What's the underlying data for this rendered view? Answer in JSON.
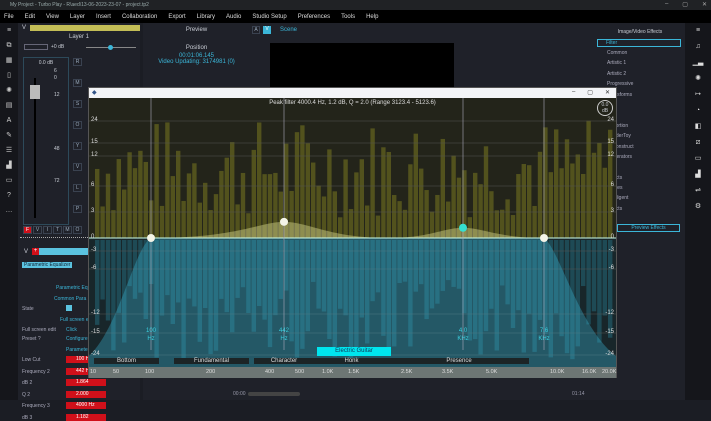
{
  "window": {
    "title": "My Project - Turbo Play - R\\aed\\13-06-2023-23-07 - project.tp2",
    "controls": [
      "–",
      "▢",
      "✕"
    ]
  },
  "menu": [
    "File",
    "Edit",
    "View",
    "Layer",
    "Insert",
    "Collaboration",
    "Export",
    "Library",
    "Audio",
    "Studio Setup",
    "Preferences",
    "Tools",
    "Help"
  ],
  "left_icons": [
    "menu-icon",
    "copy-icon",
    "grid-icon",
    "file-icon",
    "sparkle-icon",
    "book-icon",
    "text-icon",
    "pin-icon",
    "list-icon",
    "bars-icon",
    "folder-icon",
    "help-icon",
    "more-icon"
  ],
  "layer": {
    "label": "V",
    "name": "Layer 1",
    "volume": "+0 dB",
    "fader_db": "0.0 dB",
    "scale": [
      "6",
      "0",
      "12",
      "48",
      "72"
    ],
    "side_buttons": [
      "R",
      "M",
      "S",
      "O",
      "Y",
      "V",
      "L",
      "P"
    ],
    "bottom_buttons": [
      "F",
      "V",
      "I",
      "T",
      "M",
      "O"
    ],
    "effect_label": "V",
    "effect_bar": "Eff"
  },
  "params": {
    "tag": "Parametric Equalizer",
    "heading": "Parametric Eq",
    "common": "Common Para",
    "state_label": "State",
    "fullscreen_heading": "Full screen e",
    "fullscreen_label": "Full screen edit",
    "fullscreen_value": "Click",
    "preset_label": "Preset ?",
    "preset_value": "Configure",
    "param_heading": "Parameter",
    "rows": [
      {
        "label": "Low Cut",
        "value": "100 Hz"
      },
      {
        "label": "Frequency 2",
        "value": "442 Hz"
      },
      {
        "label": "dB 2",
        "value": "1.864"
      },
      {
        "label": "Q 2",
        "value": "2.000"
      },
      {
        "label": "Frequency 3",
        "value": "4000 Hz"
      },
      {
        "label": "dB 3",
        "value": "1.182"
      }
    ]
  },
  "preview": {
    "title": "Preview",
    "position_label": "Position",
    "time": "00:01:06.145",
    "updating": "Video Updating: 3174981 (0)"
  },
  "scene": {
    "tab_a": "A",
    "tab_v": "V",
    "tab_scene": "Scene",
    "timeline_start": "00:00",
    "timeline_end": "01:14"
  },
  "effects": {
    "title": "Image/Video Effects",
    "filter_placeholder": "Filter",
    "items": [
      "Common",
      "Artistic 1",
      "Artistic 2",
      "Progressive",
      "Transforms",
      "t",
      "r",
      "Distortion",
      "ShaderToy",
      "Deconstruct",
      "Generators",
      "nd",
      "Effects",
      "Sprites",
      "Intelligent",
      "Effects"
    ],
    "preview_button": "Preview Effects"
  },
  "right_icons": [
    "menu-icon",
    "music-icon",
    "signal-icon",
    "sparkle-icon",
    "arrow-right-icon",
    "mask-icon",
    "split-icon",
    "crop-icon",
    "monitor-icon",
    "bars-icon",
    "sliders-icon",
    "gear-icon"
  ],
  "eq": {
    "title_icon": "app-icon",
    "info": "Peak filter 4000.4 Hz, 1.2 dB, Q = 2.0 (Range 3123.4 - 5123.6)",
    "gain_readout": "0.0\ndB",
    "db_ticks": [
      "24",
      "15",
      "12",
      "6",
      "3",
      "0",
      "-3",
      "-6",
      "-12",
      "-15",
      "-24"
    ],
    "nodes": [
      {
        "freq": "100",
        "unit": "Hz",
        "db": 0
      },
      {
        "freq": "442",
        "unit": "Hz",
        "db": 1.864
      },
      {
        "freq": "4.0",
        "unit": "KHz",
        "db": 1.182
      },
      {
        "freq": "7.6",
        "unit": "KHz",
        "db": 0
      }
    ],
    "freq_ticks": [
      "10",
      "50",
      "100",
      "200",
      "400",
      "500",
      "1.0K",
      "1.5K",
      "2.5K",
      "3.5K",
      "5.0K",
      "10.0K",
      "16.0K",
      "20.0K"
    ],
    "bands": [
      "Bottom",
      "Fundamental",
      "Character",
      "Honk",
      "Presence"
    ],
    "instrument": "Electric Guitar",
    "colors": {
      "upper_bars": "#5a5a1e",
      "lower_bars": "#1f4f5a",
      "node_selected": "#35e0d0",
      "accent": "#3bb6d8",
      "label_bg": "#00e5ee"
    }
  }
}
